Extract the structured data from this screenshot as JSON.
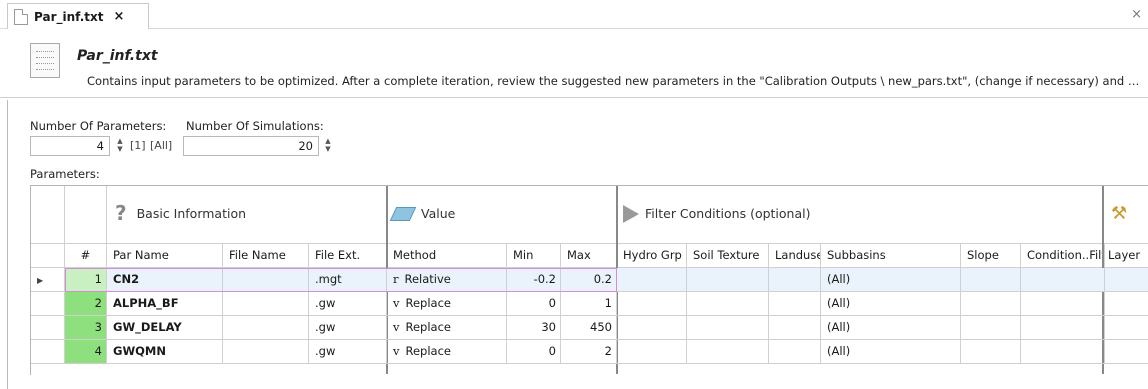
{
  "tab": {
    "label": "Par_inf.txt",
    "close": "×"
  },
  "window_close": "×",
  "header": {
    "title": "Par_inf.txt",
    "description": "Contains input parameters to be optimized. After a complete iteration, review the suggested new parameters in the \"Calibration Outputs \\ new_pars.txt\", (change if necessary) and copy them to ..."
  },
  "controls": {
    "num_params_label": "Number Of Parameters:",
    "num_params_value": "4",
    "btn_one": "[1]",
    "btn_all": "[All]",
    "num_sims_label": "Number Of Simulations:",
    "num_sims_value": "20",
    "parameters_label": "Parameters:"
  },
  "bands": {
    "basic": "Basic Information",
    "value": "Value",
    "filter": "Filter Conditions (optional)"
  },
  "columns": [
    "#",
    "Par Name",
    "File Name",
    "File Ext.",
    "Method",
    "Min",
    "Max",
    "Hydro Grp",
    "Soil Texture",
    "Landuse",
    "Subbasins",
    "Slope",
    "Condition..Filt",
    "Layer"
  ],
  "rows": [
    {
      "num": "1",
      "name": "CN2",
      "file": "",
      "ext": ".mgt",
      "method_sym": "r",
      "method": "Relative",
      "min": "-0.2",
      "max": "0.2",
      "subbasins": "(All)"
    },
    {
      "num": "2",
      "name": "ALPHA_BF",
      "file": "",
      "ext": ".gw",
      "method_sym": "v",
      "method": "Replace",
      "min": "0",
      "max": "1",
      "subbasins": "(All)"
    },
    {
      "num": "3",
      "name": "GW_DELAY",
      "file": "",
      "ext": ".gw",
      "method_sym": "v",
      "method": "Replace",
      "min": "30",
      "max": "450",
      "subbasins": "(All)"
    },
    {
      "num": "4",
      "name": "GWQMN",
      "file": "",
      "ext": ".gw",
      "method_sym": "v",
      "method": "Replace",
      "min": "0",
      "max": "2",
      "subbasins": "(All)"
    }
  ],
  "colors": {
    "row_num_bg": "#8ee07f",
    "selected_row": "#eaf3fb",
    "selection_border": "#d68bd6"
  }
}
